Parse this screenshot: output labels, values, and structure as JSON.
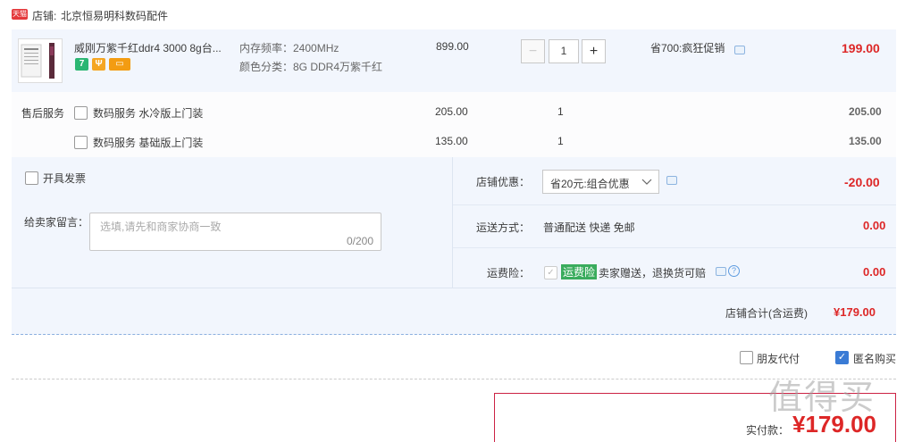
{
  "shop": {
    "logo_text": "天猫",
    "label": "店铺:",
    "name": "北京恒易明科数码配件"
  },
  "item": {
    "title": "威刚万紫千红ddr4 3000 8g台...",
    "spec_freq": "内存频率：2400MHz",
    "spec_color": "颜色分类：8G DDR4万紫千红",
    "badges": [
      "7",
      "Ψ",
      "▭"
    ],
    "unit_price": "899.00",
    "quantity": "1",
    "minus": "−",
    "plus": "+",
    "promo": "省700:疯狂促销",
    "subtotal": "199.00"
  },
  "after_sales": {
    "label": "售后服务",
    "options": [
      {
        "name": "数码服务 水冷版上门装",
        "price": "205.00",
        "qty": "1",
        "total": "205.00"
      },
      {
        "name": "数码服务 基础版上门装",
        "price": "135.00",
        "qty": "1",
        "total": "135.00"
      }
    ]
  },
  "invoice": {
    "label": "开具发票"
  },
  "message": {
    "label": "给卖家留言：",
    "placeholder": "选填,请先和商家协商一致",
    "counter": "0/200"
  },
  "discount": {
    "label": "店铺优惠：",
    "selected": "省20元:组合优惠",
    "amount": "-20.00"
  },
  "shipping": {
    "label": "运送方式：",
    "value": "普通配送 快递 免邮",
    "amount": "0.00"
  },
  "insurance": {
    "label": "运费险：",
    "tag": "运费险",
    "text": "卖家赠送，退换货可赔",
    "qmark": "?",
    "amount": "0.00"
  },
  "shop_total": {
    "label": "店铺合计(含运费)",
    "amount": "¥179.00"
  },
  "options": {
    "friend_pay": "朋友代付",
    "anonymous": "匿名购买",
    "check": "✓"
  },
  "payment": {
    "label": "实付款：",
    "amount": "¥179.00"
  },
  "watermark": "值得买"
}
